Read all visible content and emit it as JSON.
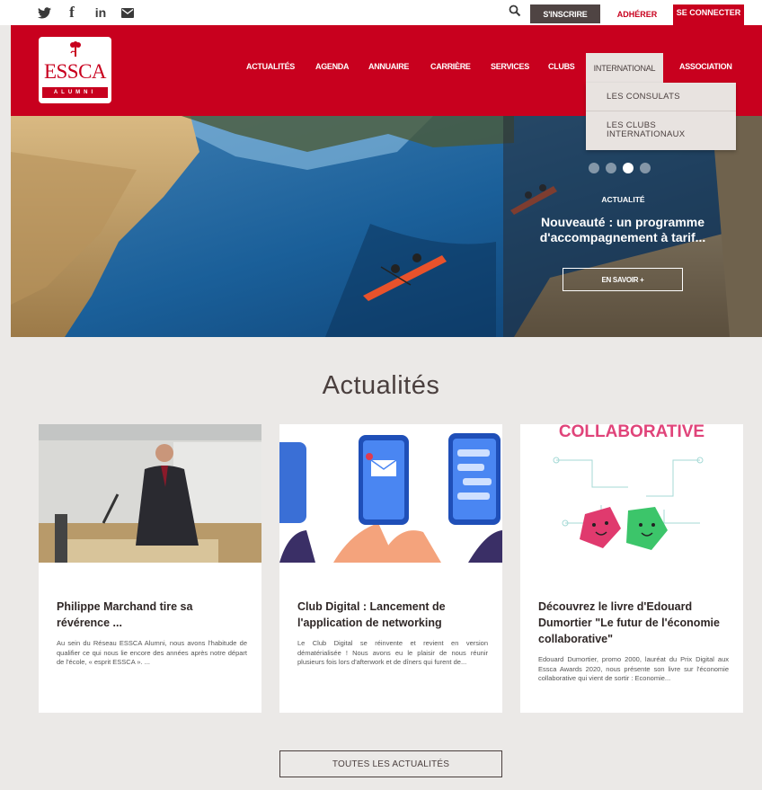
{
  "topbar": {
    "social": [
      {
        "name": "twitter-icon",
        "glyph": "🐦"
      },
      {
        "name": "facebook-icon",
        "glyph": "f"
      },
      {
        "name": "linkedin-icon",
        "glyph": "in"
      },
      {
        "name": "mail-icon",
        "glyph": "✉"
      }
    ],
    "inscrire_label": "S'INSCRIRE",
    "adherer_label": "ADHÉRER",
    "connecter_label": "SE CONNECTER"
  },
  "logo": {
    "name": "ESSCA",
    "sub": "ALUMNI"
  },
  "nav": {
    "items": [
      "ACTUALITÉS",
      "AGENDA",
      "ANNUAIRE",
      "CARRIÈRE",
      "SERVICES",
      "CLUBS",
      "INTERNATIONAL",
      "ASSOCIATION"
    ],
    "dropdown": [
      "LES CONSULATS",
      "LES CLUBS INTERNATIONAUX"
    ]
  },
  "hero": {
    "kicker": "ACTUALITÉ",
    "title": "Nouveauté : un programme d'accompagnement à tarif...",
    "button": "EN SAVOIR +",
    "slide_count": 4,
    "active_slide": 3
  },
  "news": {
    "heading": "Actualités",
    "cards": [
      {
        "title": "Philippe Marchand tire sa révérence ...",
        "excerpt": "Au sein du Réseau ESSCA Alumni, nous avons l'habitude de qualifier ce qui nous lie encore des années après notre départ de l'école, « esprit ESSCA ». ..."
      },
      {
        "title": "Club Digital : Lancement de l'application de networking",
        "excerpt": "Le Club Digital se réinvente et revient en version dématérialisée ! Nous avons eu le plaisir de nous réunir plusieurs fois lors d'afterwork et de dîners qui furent de..."
      },
      {
        "title": "Découvrez le livre d'Edouard Dumortier \"Le futur de l'économie collaborative\"",
        "excerpt": "Edouard Dumortier, promo 2000, lauréat du Prix Digital aux Essca Awards 2020, nous présente son livre sur l'économie collaborative qui vient de sortir : Economie...",
        "image_caption": "COLLABORATIVE"
      }
    ],
    "all_button": "TOUTES LES ACTUALITÉS"
  },
  "colors": {
    "brand_red": "#c8001e",
    "dark_brown": "#4f4443",
    "page_bg": "#ebe9e7"
  }
}
